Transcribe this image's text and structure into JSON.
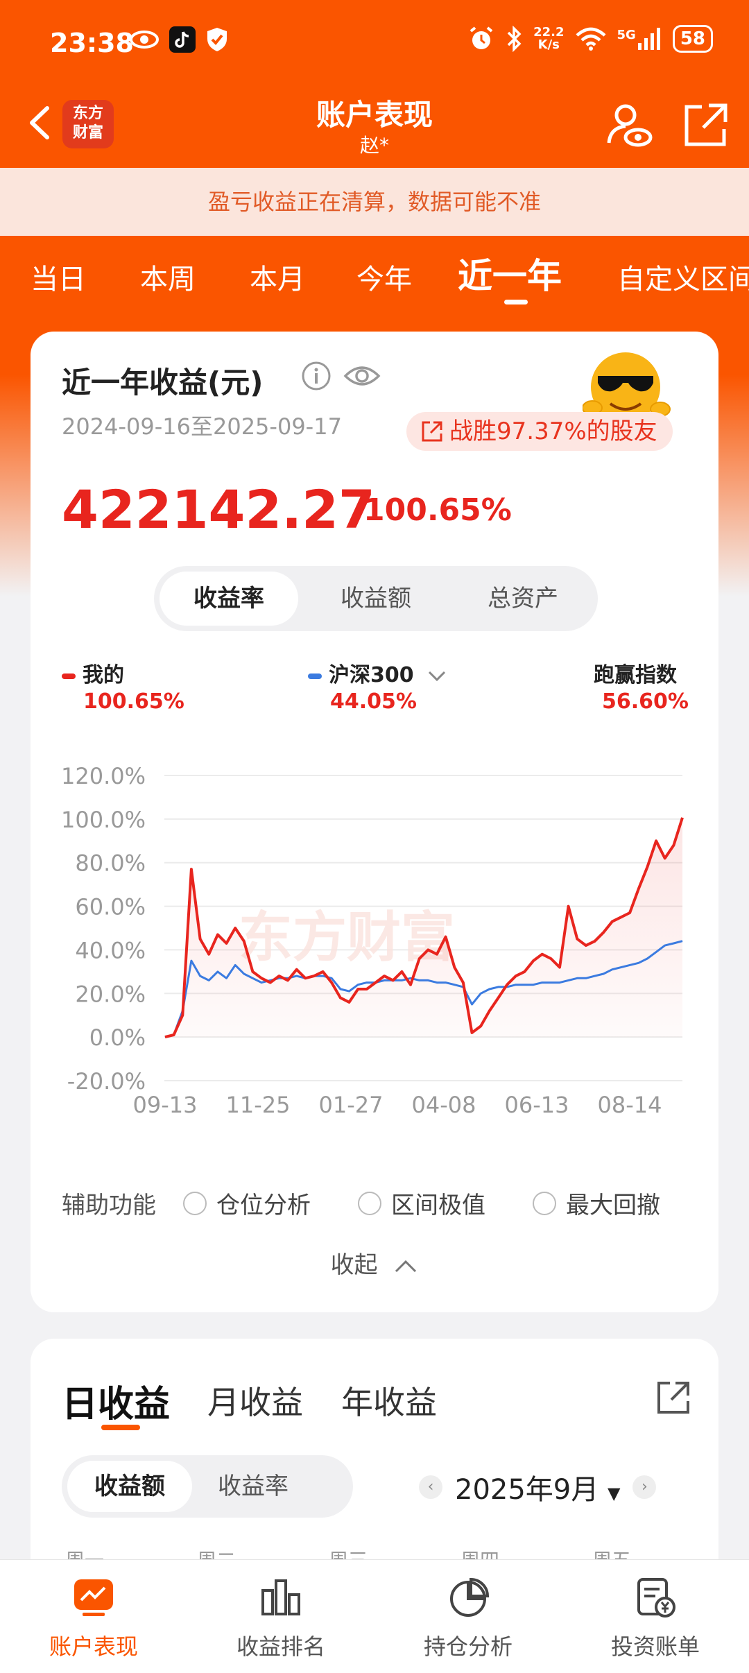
{
  "status_bar": {
    "time": "23:38",
    "net_speed_top": "22.2",
    "net_speed_bottom": "K/s",
    "signal": "5G",
    "battery": "58"
  },
  "header": {
    "logo_line1": "东方",
    "logo_line2": "财富",
    "title": "账户表现",
    "subtitle": "赵*"
  },
  "notice": "盈亏收益正在清算，数据可能不准",
  "period_tabs": [
    "当日",
    "本周",
    "本月",
    "今年",
    "近一年",
    "自定义区间"
  ],
  "period_active": "近一年",
  "summary": {
    "title": "近一年收益(元)",
    "date_range": "2024-09-16至2025-09-17",
    "beat_text": "战胜97.37%的股友",
    "profit": "422142.27",
    "profit_pct": "100.65%"
  },
  "segments": [
    "收益率",
    "收益额",
    "总资产"
  ],
  "legend": {
    "mine_label": "我的",
    "mine_value": "100.65%",
    "index_label": "沪深300",
    "index_value": "44.05%",
    "beat_label": "跑赢指数",
    "beat_value": "56.60%"
  },
  "chart_data": {
    "type": "line",
    "x_ticks": [
      "09-13",
      "11-25",
      "01-27",
      "04-08",
      "06-13",
      "08-14"
    ],
    "y_ticks": [
      "120.0%",
      "100.0%",
      "80.0%",
      "60.0%",
      "40.0%",
      "20.0%",
      "0.0%",
      "-20.0%"
    ],
    "ylim": [
      -20,
      120
    ],
    "watermark": "东方财富",
    "series": [
      {
        "name": "我的",
        "color": "#e8251e",
        "values": [
          0,
          1,
          10,
          77,
          45,
          38,
          47,
          43,
          50,
          44,
          30,
          27,
          25,
          28,
          26,
          31,
          27,
          28,
          30,
          25,
          18,
          16,
          22,
          22,
          25,
          28,
          26,
          30,
          24,
          36,
          40,
          38,
          46,
          32,
          25,
          2,
          5,
          12,
          18,
          24,
          28,
          30,
          35,
          38,
          36,
          32,
          60,
          45,
          42,
          44,
          48,
          53,
          55,
          57,
          68,
          78,
          90,
          82,
          88,
          100.65
        ]
      },
      {
        "name": "沪深300",
        "color": "#3b7be0",
        "values": [
          0,
          1,
          12,
          35,
          28,
          26,
          30,
          27,
          33,
          29,
          27,
          25,
          26,
          27,
          27,
          28,
          27,
          28,
          28,
          27,
          22,
          21,
          24,
          25,
          25,
          26,
          26,
          26,
          27,
          26,
          26,
          25,
          25,
          24,
          23,
          15,
          20,
          22,
          23,
          23,
          24,
          24,
          24,
          25,
          25,
          25,
          26,
          27,
          27,
          28,
          29,
          31,
          32,
          33,
          34,
          36,
          39,
          42,
          43,
          44.05
        ]
      }
    ]
  },
  "aux": {
    "label": "辅助功能",
    "options": [
      "仓位分析",
      "区间极值",
      "最大回撤"
    ],
    "collapse": "收起"
  },
  "daily": {
    "tabs": [
      "日收益",
      "月收益",
      "年收益"
    ],
    "segments": [
      "收益额",
      "收益率"
    ],
    "month": "2025年9月",
    "weekdays": [
      "周一",
      "周二",
      "周三",
      "周四",
      "周五"
    ]
  },
  "bottom_nav": [
    "账户表现",
    "收益排名",
    "持仓分析",
    "投资账单"
  ]
}
